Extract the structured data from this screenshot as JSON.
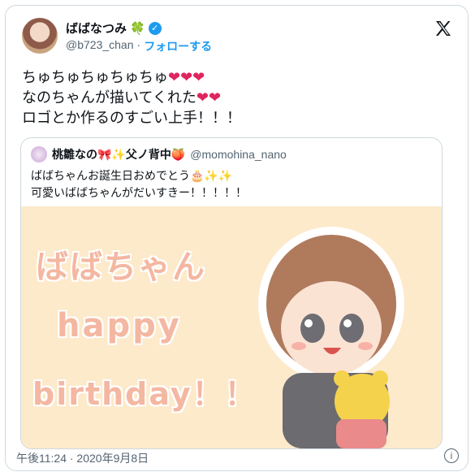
{
  "author": {
    "name": "ばばなつみ",
    "name_emoji": "🍀",
    "handle": "@b723_chan",
    "follow_label": "フォローする"
  },
  "tweet": {
    "line1": "ちゅちゅちゅちゅちゅ",
    "line2": "なのちゃんが描いてくれた",
    "line3": "ロゴとか作るのすごい上手！！！",
    "hearts1": "❤❤❤",
    "hearts2": "❤❤"
  },
  "quote": {
    "name": "桃雛なの🎀✨父ノ背中🍑",
    "handle": "@momohina_nano",
    "line1": "ばばちゃんお誕生日おめでとう🎂✨✨",
    "line2": "可愛いばばちゃんがだいすきー！！！！！",
    "image_text": {
      "line1": "ばばちゃん",
      "line2": "happy",
      "line3": "birthday！！"
    }
  },
  "footer": {
    "timestamp": "午後11:24 · 2020年9月8日",
    "info_glyph": "i"
  },
  "icons": [
    "x-logo-icon",
    "verified-badge-icon",
    "info-icon"
  ],
  "colors": {
    "accent": "#1d9bf0",
    "heart": "#e0245e",
    "image_bg": "#fdeacb",
    "image_text": "#f4b7a1"
  }
}
